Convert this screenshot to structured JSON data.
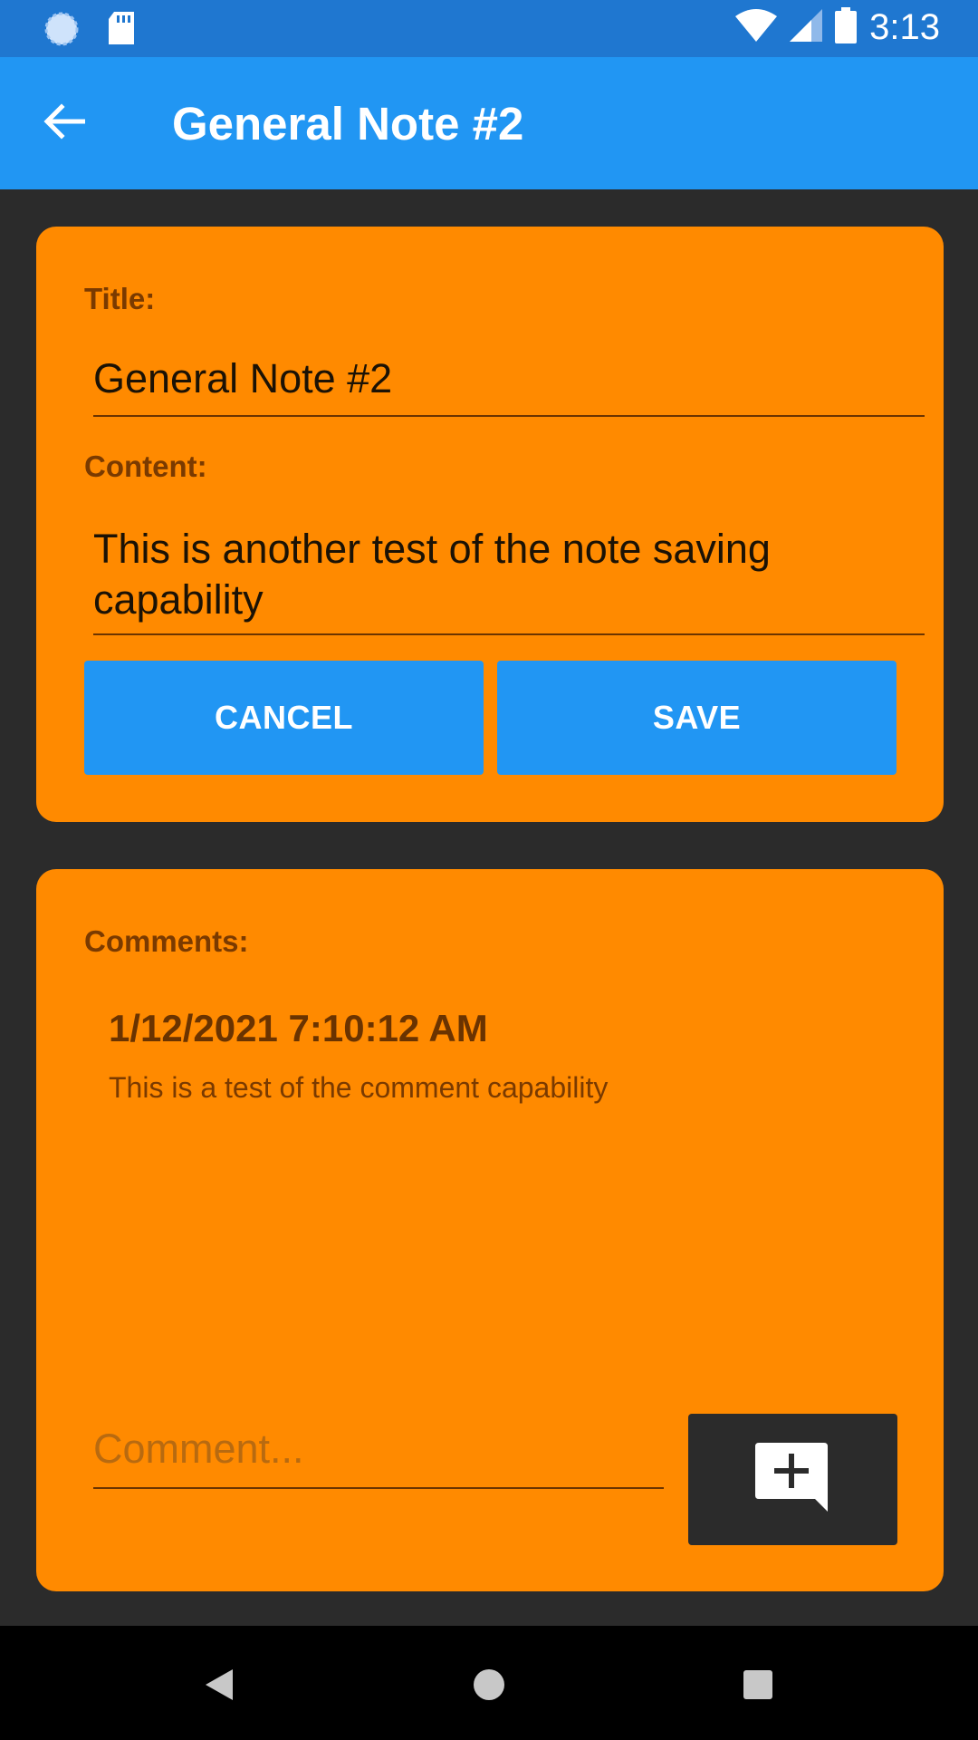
{
  "status_bar": {
    "time": "3:13",
    "icons": [
      "sync-icon",
      "sd-card-icon",
      "wifi-icon",
      "signal-icon",
      "battery-icon"
    ]
  },
  "app_bar": {
    "title": "General Note #2",
    "back_icon": "arrow-left-icon"
  },
  "note": {
    "title_label": "Title:",
    "title_value": "General Note #2",
    "content_label": "Content:",
    "content_value": "This is another test of the note saving capability",
    "cancel_label": "CANCEL",
    "save_label": "SAVE"
  },
  "comments": {
    "label": "Comments:",
    "items": [
      {
        "timestamp": "1/12/2021 7:10:12 AM",
        "text": "This is a test of the comment capability"
      }
    ],
    "input_placeholder": "Comment...",
    "add_icon": "add-comment-icon"
  },
  "colors": {
    "status_bar": "#1f77d0",
    "app_bar": "#2196f3",
    "card": "#ff8a00",
    "background": "#2b2b2b",
    "button": "#2196f3"
  },
  "nav_bar": {
    "icons": [
      "back-triangle-icon",
      "home-circle-icon",
      "recents-square-icon"
    ]
  }
}
